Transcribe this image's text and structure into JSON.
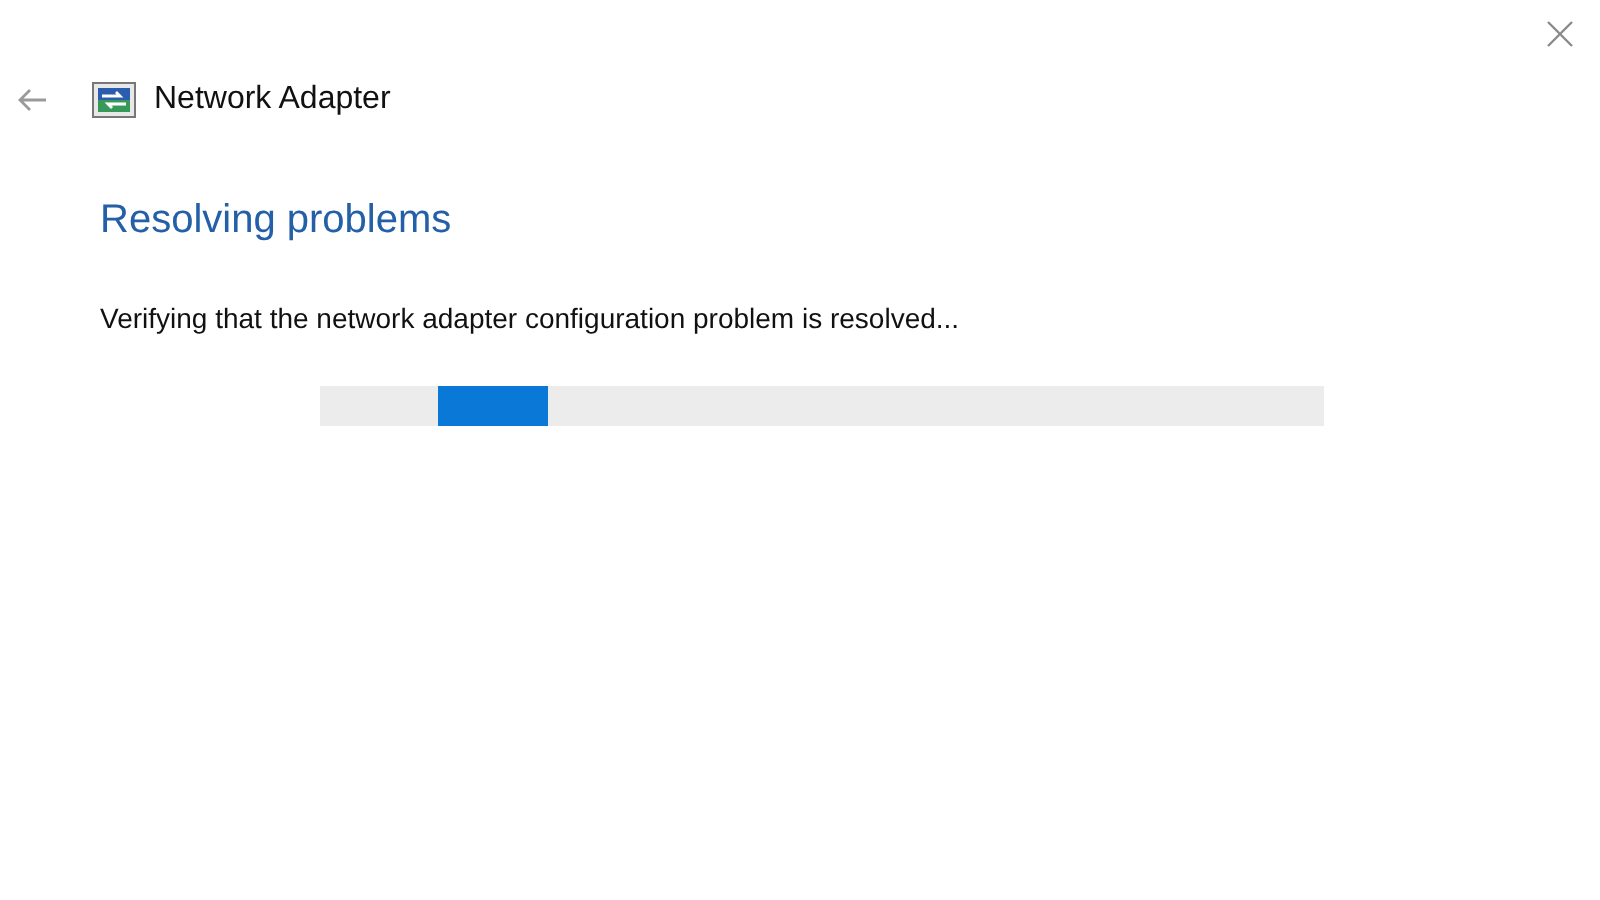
{
  "window": {
    "title": "Network Adapter"
  },
  "heading": "Resolving problems",
  "message": "Verifying that the network adapter configuration problem is resolved...",
  "progress": {
    "kind": "marquee"
  }
}
